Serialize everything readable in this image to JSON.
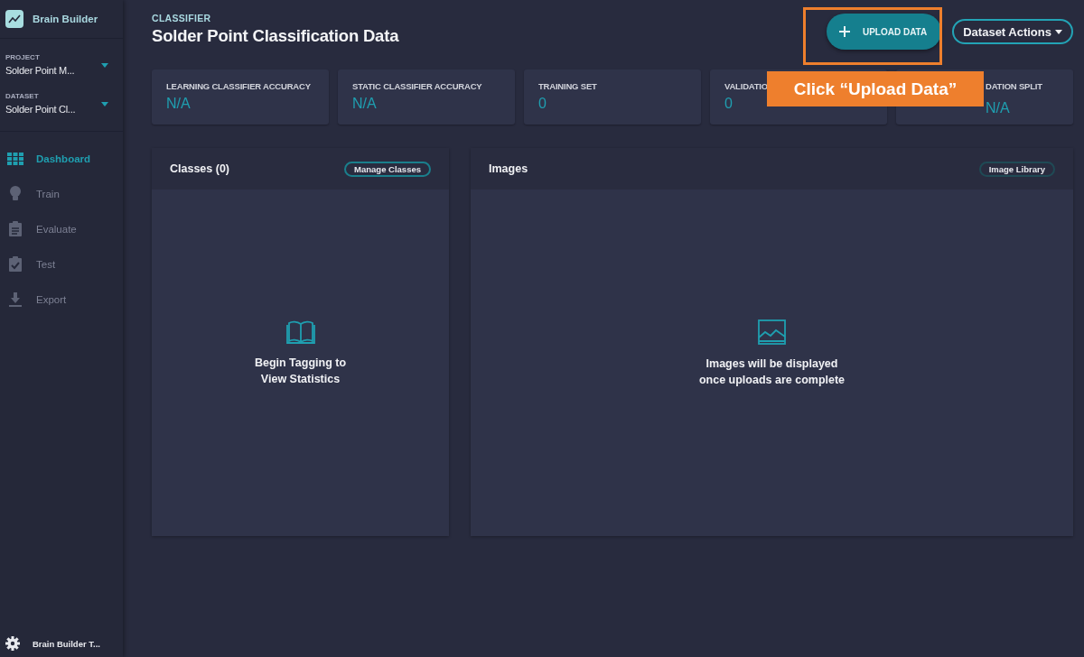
{
  "sidebar": {
    "brand": "Brain Builder",
    "selectors": [
      {
        "label": "PROJECT",
        "value": "Solder Point M..."
      },
      {
        "label": "DATASET",
        "value": "Solder Point Cl..."
      }
    ],
    "nav": [
      {
        "label": "Dashboard",
        "selected": true
      },
      {
        "label": "Train",
        "selected": false
      },
      {
        "label": "Evaluate",
        "selected": false
      },
      {
        "label": "Test",
        "selected": false
      },
      {
        "label": "Export",
        "selected": false
      }
    ],
    "footer": "Brain Builder T..."
  },
  "header": {
    "eyebrow": "CLASSIFIER",
    "title": "Solder Point Classification Data",
    "upload_button": "UPLOAD DATA",
    "actions_button": "Dataset Actions"
  },
  "stats": [
    {
      "label": "LEARNING CLASSIFIER ACCURACY",
      "value": "N/A"
    },
    {
      "label": "STATIC CLASSIFIER ACCURACY",
      "value": "N/A"
    },
    {
      "label": "TRAINING SET",
      "value": "0"
    },
    {
      "label": "VALIDATIO",
      "value": "0"
    },
    {
      "label": "DATION SPLIT",
      "value": "N/A"
    }
  ],
  "panels": [
    {
      "title": "Classes (0)",
      "button": "Manage Classes",
      "message": "Begin Tagging to View Statistics"
    },
    {
      "title": "Images",
      "button": "Image Library",
      "message": "Images will be displayed once uploads are complete"
    }
  ],
  "callout": "Click “Upload Data”"
}
